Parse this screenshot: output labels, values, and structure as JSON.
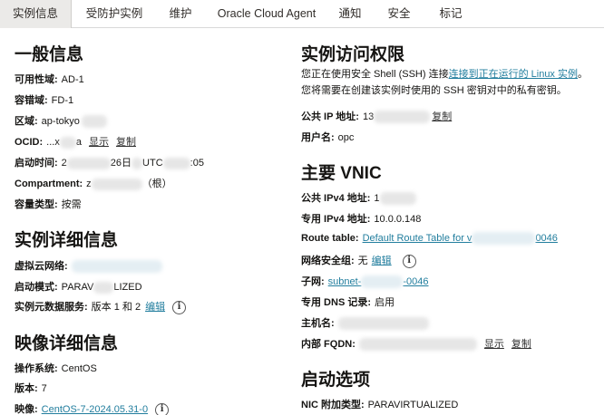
{
  "tabs": [
    "实例信息",
    "受防护实例",
    "维护",
    "Oracle Cloud Agent",
    "通知",
    "安全",
    "标记"
  ],
  "general": {
    "title": "一般信息",
    "ad_label": "可用性域:",
    "ad_value": "AD-1",
    "fd_label": "容错域:",
    "fd_value": "FD-1",
    "region_label": "区域:",
    "region_value": "ap-tokyo",
    "ocid_label": "OCID:",
    "ocid_value": "...x",
    "ocid_tail": "a",
    "show": "显示",
    "copy": "复制",
    "start_label": "启动时间:",
    "start_value_a": "2",
    "start_value_b": "26日",
    "start_value_c": "UTC",
    "start_value_d": ":05",
    "compartment_label": "Compartment:",
    "compartment_value_a": "z",
    "compartment_value_b": "（根）",
    "capacity_label": "容量类型:",
    "capacity_value": "按需"
  },
  "instance_details": {
    "title": "实例详细信息",
    "vcn_label": "虚拟云网络:",
    "mode_label": "启动模式:",
    "mode_value_a": "PARAV",
    "mode_value_b": "LIZED",
    "imds_label": "实例元数据服务:",
    "imds_value": "版本 1 和 2",
    "edit": "编辑"
  },
  "image_details": {
    "title": "映像详细信息",
    "os_label": "操作系统:",
    "os_value": "CentOS",
    "version_label": "版本:",
    "version_value": "7",
    "image_label": "映像:",
    "image_value": "CentOS-7-2024.05.31-0"
  },
  "access": {
    "title": "实例访问权限",
    "text_pre": "您正在使用安全 Shell (SSH) 连接",
    "text_link": "连接到正在运行的 Linux 实例",
    "text_post": "。您将需要在创建该实例时使用的 SSH 密钥对中的私有密钥。",
    "ip_label": "公共 IP 地址:",
    "ip_value": "13",
    "copy": "复制",
    "user_label": "用户名:",
    "user_value": "opc"
  },
  "vnic": {
    "title": "主要 VNIC",
    "pub_label": "公共 IPv4 地址:",
    "pub_value": "1",
    "priv_label": "专用 IPv4 地址:",
    "priv_value": "10.0.0.148",
    "rt_label": "Route table:",
    "rt_value_a": "Default Route Table for v",
    "rt_value_b": "0046",
    "nsg_label": "网络安全组:",
    "nsg_value": "无",
    "nsg_edit": "编辑",
    "subnet_label": "子网:",
    "subnet_value_a": "subnet-",
    "subnet_value_b": "-0046",
    "dns_label": "专用 DNS 记录:",
    "dns_value": "启用",
    "host_label": "主机名:",
    "fqdn_label": "内部 FQDN:",
    "show": "显示",
    "copy": "复制"
  },
  "launch": {
    "title": "启动选项",
    "nic_label": "NIC 附加类型:",
    "nic_value": "PARAVIRTUALIZED"
  }
}
